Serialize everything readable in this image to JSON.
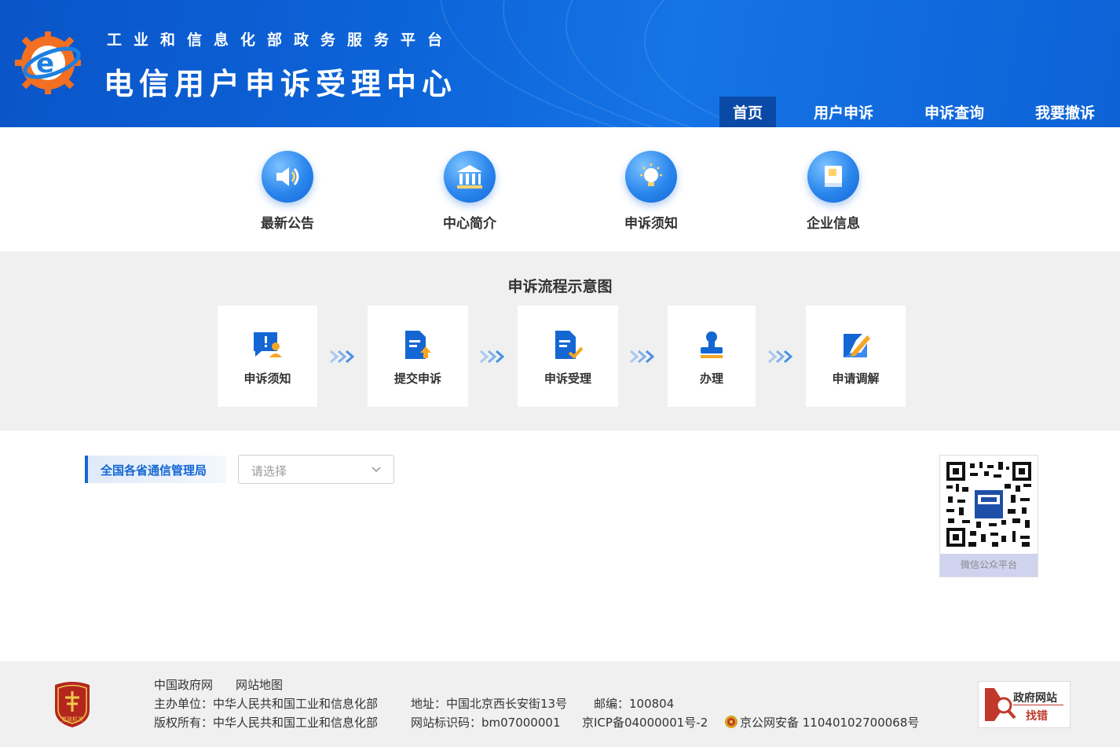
{
  "header": {
    "platform_title": "工业和信息化部政务服务平台",
    "center_title": "电信用户申诉受理中心",
    "nav": [
      {
        "label": "首页",
        "active": true
      },
      {
        "label": "用户申诉",
        "active": false
      },
      {
        "label": "申诉查询",
        "active": false
      },
      {
        "label": "我要撤诉",
        "active": false
      }
    ]
  },
  "quick_links": [
    {
      "label": "最新公告",
      "icon": "speaker-icon"
    },
    {
      "label": "中心简介",
      "icon": "building-icon"
    },
    {
      "label": "申诉须知",
      "icon": "lightbulb-icon"
    },
    {
      "label": "企业信息",
      "icon": "book-icon"
    }
  ],
  "flow": {
    "title": "申诉流程示意图",
    "steps": [
      {
        "label": "申诉须知",
        "icon": "notice-chat-icon"
      },
      {
        "label": "提交申诉",
        "icon": "document-upload-icon"
      },
      {
        "label": "申诉受理",
        "icon": "document-check-icon"
      },
      {
        "label": "办理",
        "icon": "stamp-icon"
      },
      {
        "label": "申请调解",
        "icon": "edit-note-icon"
      }
    ]
  },
  "province": {
    "label": "全国各省通信管理局",
    "select_placeholder": "请选择"
  },
  "qr": {
    "label": "微信公众平台"
  },
  "footer": {
    "links": [
      "中国政府网",
      "网站地图"
    ],
    "sponsor": "主办单位：中华人民共和国工业和信息化部",
    "address": "地址：中国北京西长安街13号",
    "postcode": "邮编：100804",
    "copyright": "版权所有：中华人民共和国工业和信息化部",
    "site_code": "网站标识码：bm07000001",
    "icp": "京ICP备04000001号-2",
    "police": "京公网安备 11040102700068号",
    "badge_text": "党政机关",
    "gov_error_line1": "政府网站",
    "gov_error_line2": "找错"
  },
  "colors": {
    "header_blue": "#0c63d8",
    "nav_active": "#0a4aa6",
    "accent_blue": "#1467d3",
    "accent_orange": "#f5a623",
    "footer_bg": "#f0f0f0"
  }
}
